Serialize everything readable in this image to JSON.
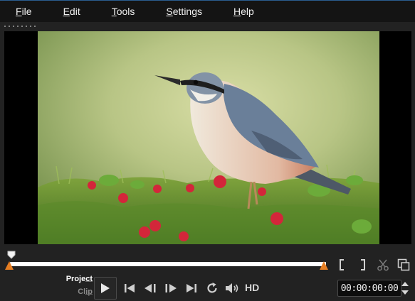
{
  "menu": {
    "items": [
      {
        "label": "File"
      },
      {
        "label": "Edit"
      },
      {
        "label": "Tools"
      },
      {
        "label": "Settings"
      },
      {
        "label": "Help"
      }
    ]
  },
  "preview": {
    "content": "bird-photo"
  },
  "playback": {
    "project_label": "Project",
    "clip_label": "Clip",
    "hd_label": "HD",
    "timecode": "00:00:00:00",
    "position": 0.0
  },
  "icons": {
    "mark_in": "bracket-left-icon",
    "mark_out": "bracket-right-icon",
    "cut": "scissors-icon",
    "copy": "copy-icon",
    "play": "play-icon",
    "go_start": "go-to-start-icon",
    "prev_frame": "previous-frame-icon",
    "next_frame": "next-frame-icon",
    "go_end": "go-to-end-icon",
    "loop": "loop-icon",
    "volume": "volume-icon"
  },
  "colors": {
    "accent_orange": "#e67e22",
    "menu_bg": "#141414",
    "panel_bg": "#222222"
  }
}
